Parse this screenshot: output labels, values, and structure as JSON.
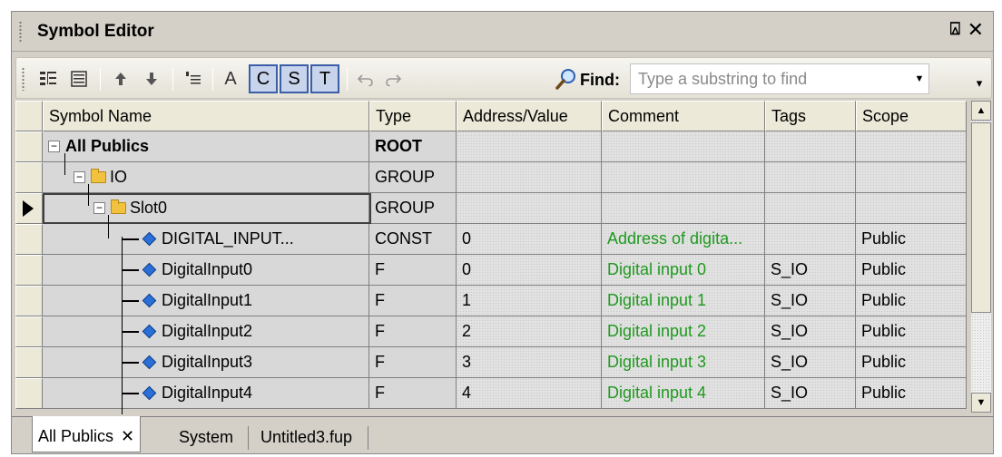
{
  "title": "Symbol Editor",
  "title_buttons": {
    "pin": "⍓",
    "close": "✕"
  },
  "toolbar": {
    "toggle_a": "A",
    "toggle_c": "C",
    "toggle_s": "S",
    "toggle_t": "T",
    "find_label": "Find:",
    "find_placeholder": "Type a substring to find",
    "icons": [
      "tree-view-icon",
      "list-view-icon",
      "move-up-icon",
      "move-down-icon",
      "insert-row-icon",
      "undo-icon",
      "redo-icon",
      "search-icon"
    ]
  },
  "columns": [
    "Symbol Name",
    "Type",
    "Address/Value",
    "Comment",
    "Tags",
    "Scope"
  ],
  "rows": [
    {
      "name": "All Publics",
      "type": "ROOT",
      "address": "",
      "comment": "",
      "tags": "",
      "scope": "",
      "kind": "root"
    },
    {
      "name": "IO",
      "type": "GROUP",
      "address": "",
      "comment": "",
      "tags": "",
      "scope": "",
      "kind": "group1"
    },
    {
      "name": "Slot0",
      "type": "GROUP",
      "address": "",
      "comment": "",
      "tags": "",
      "scope": "",
      "kind": "group2"
    },
    {
      "name": "DIGITAL_INPUT...",
      "type": "CONST",
      "address": "0",
      "comment": "Address of digita...",
      "tags": "",
      "scope": "Public",
      "kind": "leaf"
    },
    {
      "name": "DigitalInput0",
      "type": "F",
      "address": "0",
      "comment": "Digital input 0",
      "tags": "S_IO",
      "scope": "Public",
      "kind": "leaf"
    },
    {
      "name": "DigitalInput1",
      "type": "F",
      "address": "1",
      "comment": "Digital input 1",
      "tags": "S_IO",
      "scope": "Public",
      "kind": "leaf"
    },
    {
      "name": "DigitalInput2",
      "type": "F",
      "address": "2",
      "comment": "Digital input 2",
      "tags": "S_IO",
      "scope": "Public",
      "kind": "leaf"
    },
    {
      "name": "DigitalInput3",
      "type": "F",
      "address": "3",
      "comment": "Digital input 3",
      "tags": "S_IO",
      "scope": "Public",
      "kind": "leaf"
    },
    {
      "name": "DigitalInput4",
      "type": "F",
      "address": "4",
      "comment": "Digital input 4",
      "tags": "S_IO",
      "scope": "Public",
      "kind": "leaf"
    }
  ],
  "selected_row": "Slot0",
  "tabs": [
    {
      "label": "All Publics",
      "active": true,
      "close": "✕"
    },
    {
      "label": "System",
      "active": false
    },
    {
      "label": "Untitled3.fup",
      "active": false
    }
  ],
  "colors": {
    "comment_text": "#1f9a1f",
    "toggle_border": "#3b5ea8",
    "toggle_bg": "#c8d3ec",
    "window_bg": "#d4d0c8"
  }
}
